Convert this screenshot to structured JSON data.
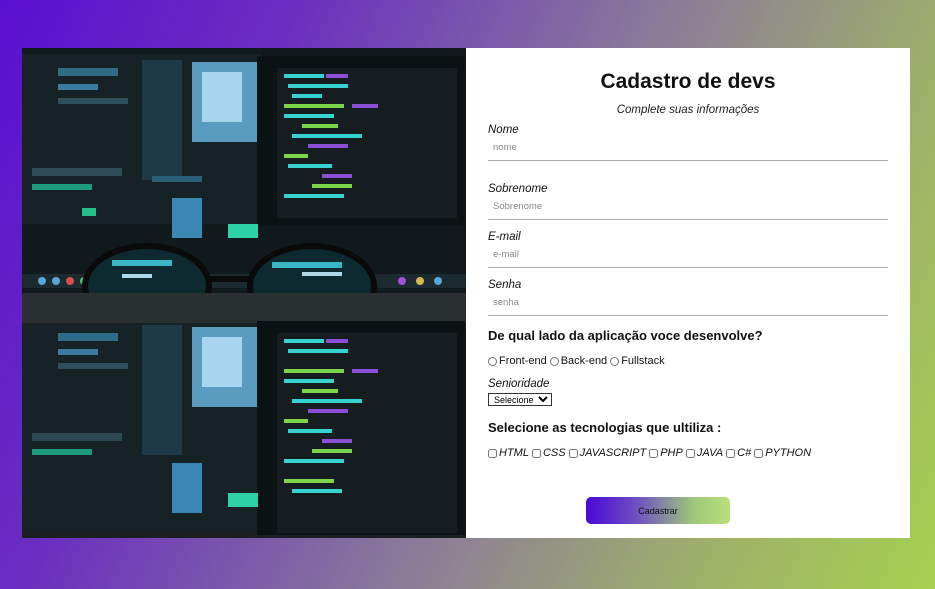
{
  "form": {
    "title": "Cadastro de devs",
    "subtitle": "Complete suas informações",
    "fields": [
      {
        "label": "Nome",
        "placeholder": "nome"
      },
      {
        "label": "Sobrenome",
        "placeholder": "Sobrenome"
      },
      {
        "label": "E-mail",
        "placeholder": "e-mail"
      },
      {
        "label": "Senha",
        "placeholder": "senha"
      }
    ],
    "side_question": "De qual lado da aplicação voce desenvolve?",
    "side_options": [
      "Front-end",
      "Back-end",
      "Fullstack"
    ],
    "seniority_label": "Senioridade",
    "seniority_selected": "Selecione",
    "tech_question": "Selecione as tecnologias que ultiliza :",
    "tech_options": [
      "HTML",
      "CSS",
      "JAVASCRIPT",
      "PHP",
      "JAVA",
      "C#",
      "PYTHON"
    ],
    "submit_label": "Cadastrar"
  },
  "colors": {
    "gradient_start": "#5a0fd0",
    "gradient_end": "#a6d14f",
    "button_start": "#4a08d6",
    "button_end": "#b8e07a"
  },
  "image": {
    "subject": "laptop-screens-with-code-and-eyeglasses"
  }
}
